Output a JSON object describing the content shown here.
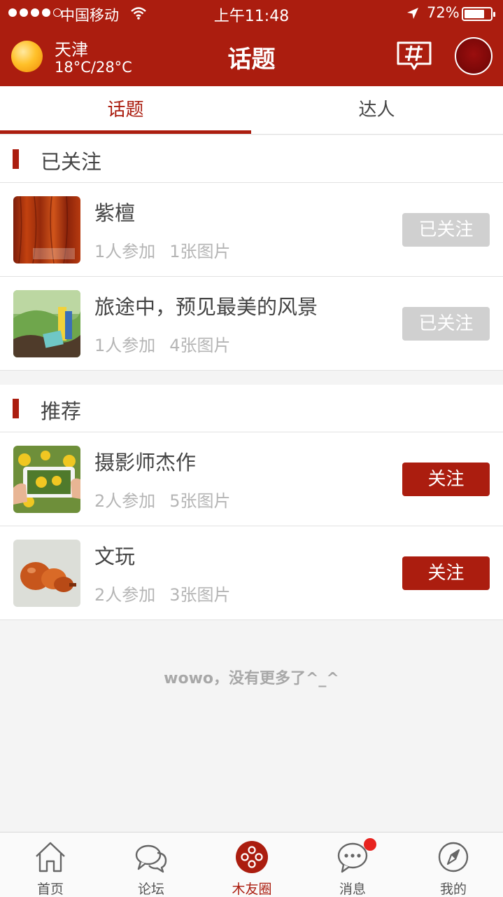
{
  "status_bar": {
    "carrier": "中国移动",
    "time": "上午11:48",
    "battery": "72%",
    "battery_level": 0.72
  },
  "header": {
    "city": "天津",
    "temperature": "18°C/28°C",
    "title": "话题",
    "icons": [
      "weather-sun-icon",
      "topic-hash-icon",
      "user-avatar"
    ]
  },
  "tabs": [
    {
      "label": "话题",
      "active": true
    },
    {
      "label": "达人",
      "active": false
    }
  ],
  "followed_section": {
    "title": "已关注",
    "items": [
      {
        "title": "紫檀",
        "participants": "1人参加",
        "images": "1张图片",
        "button": "已关注"
      },
      {
        "title": "旅途中，预见最美的风景",
        "participants": "1人参加",
        "images": "4张图片",
        "button": "已关注"
      }
    ]
  },
  "recommended_section": {
    "title": "推荐",
    "items": [
      {
        "title": "摄影师杰作",
        "participants": "2人参加",
        "images": "5张图片",
        "button": "关注"
      },
      {
        "title": "文玩",
        "participants": "2人参加",
        "images": "3张图片",
        "button": "关注"
      }
    ]
  },
  "end_text": "wowo，没有更多了^_^",
  "tabbar": [
    {
      "label": "首页",
      "icon": "home-icon",
      "active": false
    },
    {
      "label": "论坛",
      "icon": "chat-bubbles-icon",
      "active": false
    },
    {
      "label": "木友圈",
      "icon": "circle-dots-icon",
      "active": true
    },
    {
      "label": "消息",
      "icon": "message-icon",
      "active": false,
      "badge": true
    },
    {
      "label": "我的",
      "icon": "compass-icon",
      "active": false
    }
  ],
  "colors": {
    "brand": "#ab1d0f",
    "followed_button": "#d0d0d0",
    "badge": "#e8231f"
  }
}
